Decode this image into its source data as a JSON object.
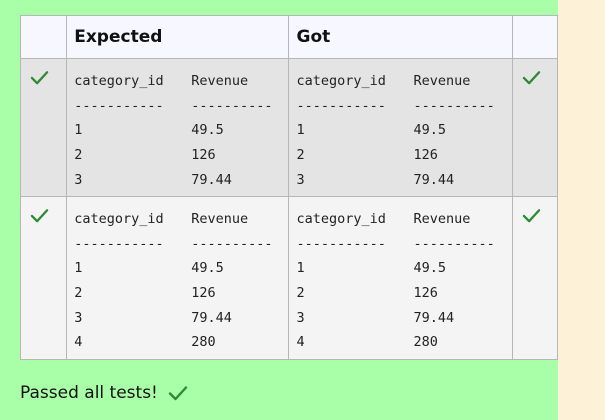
{
  "table": {
    "headers": {
      "expected": "Expected",
      "got": "Got"
    },
    "rows": [
      {
        "status": "pass",
        "expected": [
          [
            "category_id",
            "Revenue"
          ],
          [
            "-----------",
            "----------"
          ],
          [
            "1",
            "49.5"
          ],
          [
            "2",
            "126"
          ],
          [
            "3",
            "79.44"
          ]
        ],
        "got": [
          [
            "category_id",
            "Revenue"
          ],
          [
            "-----------",
            "----------"
          ],
          [
            "1",
            "49.5"
          ],
          [
            "2",
            "126"
          ],
          [
            "3",
            "79.44"
          ]
        ]
      },
      {
        "status": "pass",
        "expected": [
          [
            "category_id",
            "Revenue"
          ],
          [
            "-----------",
            "----------"
          ],
          [
            "1",
            "49.5"
          ],
          [
            "2",
            "126"
          ],
          [
            "3",
            "79.44"
          ],
          [
            "4",
            "280"
          ]
        ],
        "got": [
          [
            "category_id",
            "Revenue"
          ],
          [
            "-----------",
            "----------"
          ],
          [
            "1",
            "49.5"
          ],
          [
            "2",
            "126"
          ],
          [
            "3",
            "79.44"
          ],
          [
            "4",
            "280"
          ]
        ]
      }
    ]
  },
  "status_message": "Passed all tests!",
  "colors": {
    "panel_background": "#a8ffa8",
    "page_background": "#fdf1d8",
    "row1_background": "#e4e4e4",
    "row2_background": "#f4f4f4",
    "header_background": "#f7f8ff",
    "tick": "#2f8a35"
  },
  "icons": {
    "pass_mark": "check-icon"
  }
}
